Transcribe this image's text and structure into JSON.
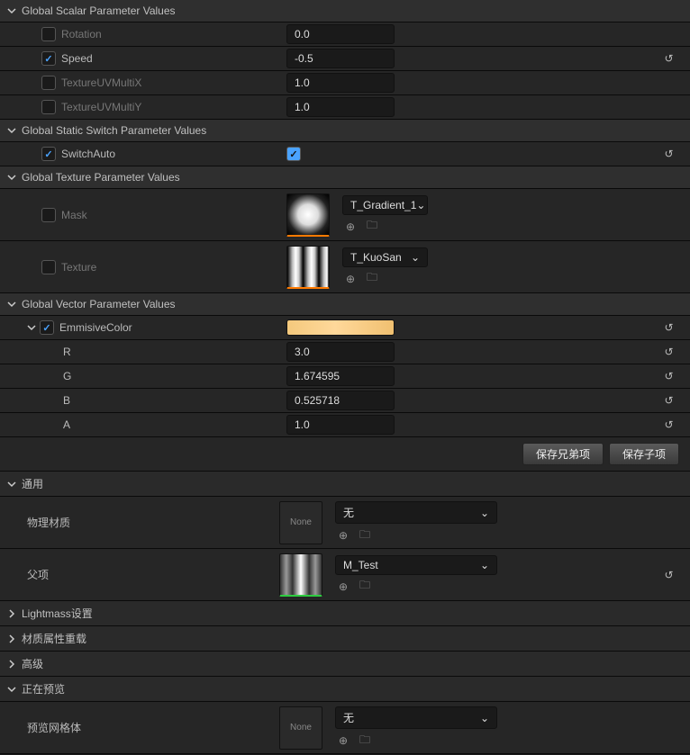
{
  "sections": {
    "scalar": "Global Scalar Parameter Values",
    "staticSwitch": "Global Static Switch Parameter Values",
    "texture": "Global Texture Parameter Values",
    "vector": "Global Vector Parameter Values",
    "general": "通用",
    "lightmass": "Lightmass设置",
    "matOverride": "材质属性重载",
    "advanced": "高级",
    "preview": "正在预览"
  },
  "scalarParams": {
    "rotation": {
      "label": "Rotation",
      "value": "0.0"
    },
    "speed": {
      "label": "Speed",
      "value": "-0.5"
    },
    "uvX": {
      "label": "TextureUVMultiX",
      "value": "1.0"
    },
    "uvY": {
      "label": "TextureUVMultiY",
      "value": "1.0"
    }
  },
  "switchParams": {
    "auto": {
      "label": "SwitchAuto"
    }
  },
  "textureParams": {
    "mask": {
      "label": "Mask",
      "asset": "T_Gradient_1"
    },
    "texture": {
      "label": "Texture",
      "asset": "T_KuoSan"
    }
  },
  "vectorParams": {
    "emissive": {
      "label": "EmmisiveColor",
      "r": {
        "label": "R",
        "value": "3.0"
      },
      "g": {
        "label": "G",
        "value": "1.674595"
      },
      "b": {
        "label": "B",
        "value": "0.525718"
      },
      "a": {
        "label": "A",
        "value": "1.0"
      }
    }
  },
  "buttons": {
    "saveSibling": "保存兄弟项",
    "saveChild": "保存子项"
  },
  "general": {
    "physMat": {
      "label": "物理材质",
      "value": "无",
      "thumb": "None"
    },
    "parent": {
      "label": "父项",
      "value": "M_Test"
    }
  },
  "previewMesh": {
    "label": "预览网格体",
    "value": "无",
    "thumb": "None"
  }
}
